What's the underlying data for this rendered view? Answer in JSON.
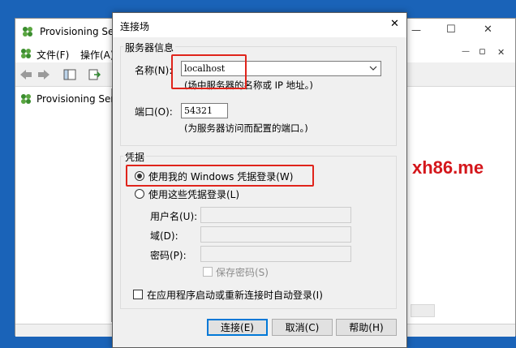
{
  "app": {
    "title": "Provisioning Se",
    "menu": {
      "file": "文件(F)",
      "action": "操作(A)"
    },
    "tree_item": "Provisioning Ser",
    "window_buttons": {
      "minimize": "—",
      "maximize": "☐",
      "close": "✕"
    },
    "inner_buttons": {
      "minimize": "—",
      "restore": "▫",
      "close": "✕"
    }
  },
  "watermark": "xh86.me",
  "dialog": {
    "title": "连接场",
    "close": "✕",
    "server_group": "服务器信息",
    "name_label": "名称(N):",
    "name_value": "localhost",
    "name_hint": "(场中服务器的名称或 IP 地址。)",
    "port_label": "端口(O):",
    "port_value": "54321",
    "port_hint": "(为服务器访问而配置的端口。)",
    "cred_group": "凭据",
    "use_windows": "使用我的 Windows 凭据登录(W)",
    "use_these": "使用这些凭据登录(L)",
    "username_label": "用户名(U):",
    "domain_label": "域(D):",
    "password_label": "密码(P):",
    "save_password": "保存密码(S)",
    "auto_login": "在应用程序启动或重新连接时自动登录(I)",
    "btn_connect": "连接(E)",
    "btn_cancel": "取消(C)",
    "btn_help": "帮助(H)"
  },
  "colors": {
    "desktop": "#1a63b8",
    "highlight": "#e0241b",
    "watermark": "#d4161b"
  }
}
